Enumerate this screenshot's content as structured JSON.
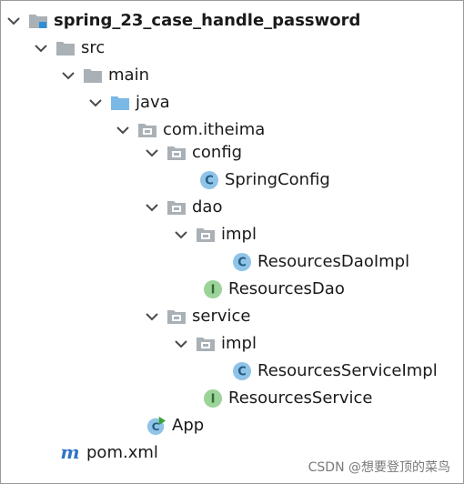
{
  "tree": {
    "project": "spring_23_case_handle_password",
    "src": "src",
    "main": "main",
    "java": "java",
    "package": "com.itheima",
    "config": "config",
    "spring_config": "SpringConfig",
    "dao": "dao",
    "dao_impl": "impl",
    "resources_dao_impl": "ResourcesDaoImpl",
    "resources_dao": "ResourcesDao",
    "service": "service",
    "service_impl": "impl",
    "resources_service_impl": "ResourcesServiceImpl",
    "resources_service": "ResourcesService",
    "app": "App",
    "pom": "pom.xml"
  },
  "icons": {
    "class_badge": "C",
    "interface_badge": "I",
    "maven_badge": "m"
  },
  "colors": {
    "class_circle": "#8fc3e8",
    "interface_circle": "#9cd39a",
    "folder_gray": "#a9b0b6",
    "source_folder_blue": "#7ab8e6",
    "maven_blue": "#2f74c4",
    "run_green": "#3aa33a"
  },
  "watermark": "CSDN @想要登顶的菜鸟"
}
